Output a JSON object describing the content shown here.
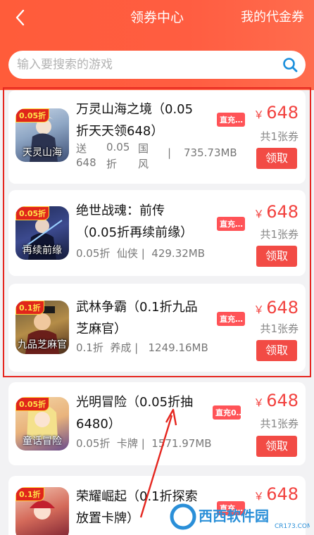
{
  "header": {
    "title": "领券中心",
    "my_coupons": "我的代金券"
  },
  "search": {
    "placeholder": "输入要搜索的游戏"
  },
  "colors": {
    "header": "#ff5c3a",
    "price": "#f2423f",
    "button": "#f24b45",
    "tag": "#ff5357"
  },
  "games": [
    {
      "name_line1": "万灵山海之境（0.05",
      "name_line2": "折天天领648）",
      "meta": [
        "送",
        "0.05",
        "国",
        "|",
        "735.73MB",
        "648",
        "折",
        "风"
      ],
      "tag": "直充…",
      "price": "648",
      "currency": "￥",
      "count": "共1张券",
      "button": "领取",
      "badge": "0.05折",
      "caption": "天灵山海"
    },
    {
      "name_line1": "绝世战魂：前传",
      "name_line2": "（0.05折再续前缘）",
      "meta_text": "0.05折  仙侠 |  429.32MB",
      "tag": "直充…",
      "price": "648",
      "currency": "￥",
      "count": "共1张券",
      "button": "领取",
      "badge": "0.05折",
      "caption": "再续前缘"
    },
    {
      "name_line1": "武林争霸（0.1折九品",
      "name_line2": "芝麻官）",
      "meta_text": "0.1折  养成 |   1249.16MB",
      "tag": "直充…",
      "price": "648",
      "currency": "￥",
      "count": "共1张券",
      "button": "领取",
      "badge": "0.1折",
      "caption": "九品芝麻官"
    },
    {
      "name_line1": "光明冒险（0.05折抽",
      "name_line2": "6480）",
      "meta_text": "0.05折  卡牌 |  1571.97MB",
      "tag": "直充0…",
      "price": "648",
      "currency": "￥",
      "count": "共1张券",
      "button": "领取",
      "badge": "0.05折",
      "caption": "童话冒险"
    },
    {
      "name_line1": "荣耀崛起（0.1折探索",
      "name_line2": "放置卡牌）",
      "tag": "直充…",
      "price": "648",
      "currency": "￥",
      "badge": "0.1折"
    }
  ],
  "watermark": {
    "brand": "西西软件园",
    "url": "CR173.COM"
  }
}
